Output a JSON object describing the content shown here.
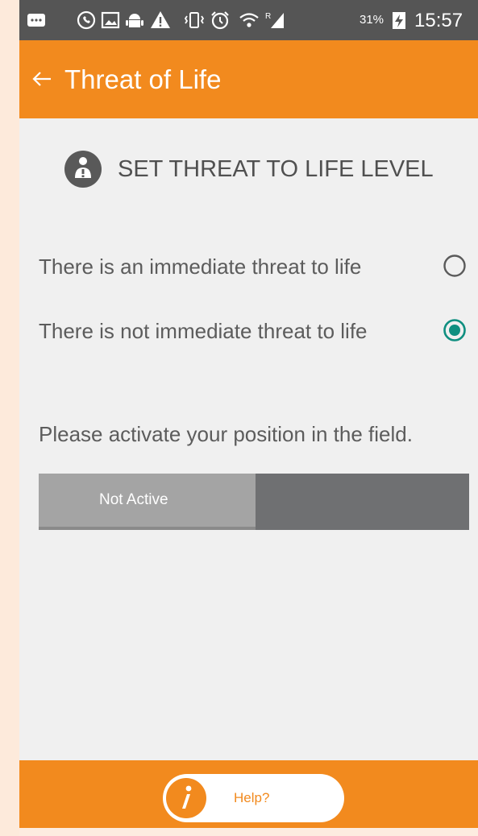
{
  "status_bar": {
    "icons": [
      "message-icon",
      "whatsapp-icon",
      "gallery-icon",
      "android-icon",
      "warning-icon",
      "vibrate-icon",
      "alarm-icon",
      "wifi-icon",
      "signal-icon",
      "battery-charging-icon"
    ],
    "roaming_mark": "R",
    "battery_percent": "31%",
    "time": "15:57"
  },
  "app_bar": {
    "back_icon": "arrow-left-icon",
    "title": "Threat of Life"
  },
  "section": {
    "icon": "person-alert-icon",
    "heading": "SET THREAT TO LIFE LEVEL"
  },
  "options": [
    {
      "label": "There is an immediate threat to life",
      "selected": false
    },
    {
      "label": "There is not immediate threat to life",
      "selected": true
    }
  ],
  "position_note": "Please activate your position in the field.",
  "position_toggle": {
    "label": "Not Active",
    "active": false
  },
  "footer": {
    "info_icon": "info-icon",
    "help_label": "Help?"
  },
  "colors": {
    "accent": "#f28a1e",
    "status_bar": "#555555",
    "radio_selected": "#0f8f80",
    "text": "#5c5c5c",
    "toggle_track": "#6f7072",
    "toggle_thumb": "#a4a4a4"
  }
}
